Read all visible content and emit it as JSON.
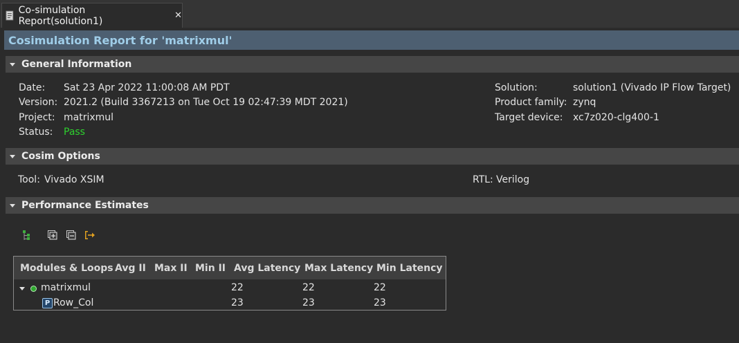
{
  "tab": {
    "title": "Co-simulation Report(solution1)",
    "close": "✕"
  },
  "report_title": "Cosimulation Report for 'matrixmul'",
  "sections": {
    "general": "General Information",
    "cosim": "Cosim Options",
    "performance": "Performance Estimates"
  },
  "general": {
    "date_label": "Date:",
    "date_value": "Sat 23 Apr 2022 11:00:08 AM PDT",
    "version_label": "Version:",
    "version_value": "2021.2 (Build 3367213 on Tue Oct 19 02:47:39 MDT 2021)",
    "project_label": "Project:",
    "project_value": "matrixmul",
    "status_label": "Status:",
    "status_value": "Pass",
    "solution_label": "Solution:",
    "solution_value": "solution1 (Vivado IP Flow Target)",
    "family_label": "Product family:",
    "family_value": "zynq",
    "device_label": "Target device:",
    "device_value": "xc7z020-clg400-1"
  },
  "cosim": {
    "tool_label": "Tool:",
    "tool_value": "Vivado XSIM",
    "rtl_label": "RTL:",
    "rtl_value": "Verilog"
  },
  "toolbar": {
    "icons": [
      "hierarchy-icon",
      "expand-all-icon",
      "collapse-all-icon",
      "jump-to-source-icon"
    ]
  },
  "perf_table": {
    "columns": [
      "Modules & Loops",
      "Avg II",
      "Max II",
      "Min II",
      "Avg Latency",
      "Max Latency",
      "Min Latency"
    ],
    "rows": [
      {
        "name": "matrixmul",
        "avg_ii": "",
        "max_ii": "",
        "min_ii": "",
        "avg_latency": "22",
        "max_latency": "22",
        "min_latency": "22"
      },
      {
        "name": "Row_Col",
        "avg_ii": "",
        "max_ii": "",
        "min_ii": "",
        "avg_latency": "23",
        "max_latency": "23",
        "min_latency": "23"
      }
    ]
  },
  "colors": {
    "status_pass": "#2ed12e",
    "header_text": "#9fcde8",
    "header_bg": "#4d5f71"
  }
}
